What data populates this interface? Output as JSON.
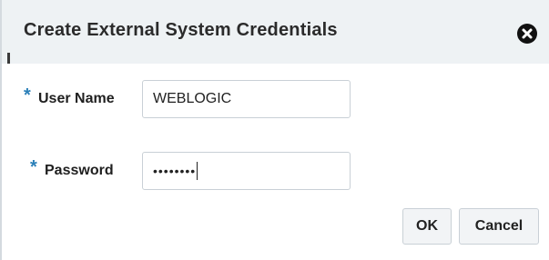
{
  "dialog": {
    "title": "Create External System Credentials",
    "close_icon": "close-circle-icon"
  },
  "form": {
    "username": {
      "required_mark": "*",
      "label": "User Name",
      "value": "WEBLOGIC"
    },
    "password": {
      "required_mark": "*",
      "label": "Password",
      "masked_value": "••••••••"
    }
  },
  "buttons": {
    "ok_label": "OK",
    "cancel_label": "Cancel"
  },
  "colors": {
    "title_bar_bg": "#eef2f4",
    "required_star": "#2a7fb8",
    "button_bg": "#f2f4f6"
  }
}
